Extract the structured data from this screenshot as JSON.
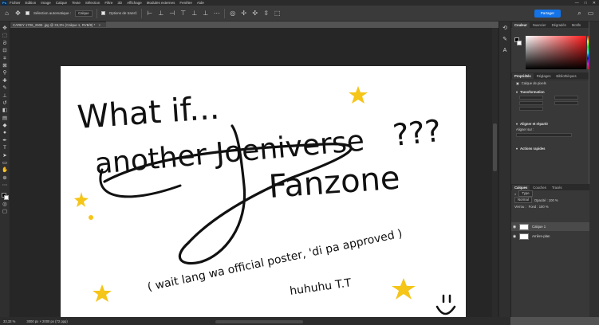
{
  "app": {
    "logo": "Ps"
  },
  "menu": [
    "Fichier",
    "Edition",
    "Image",
    "Calque",
    "Texte",
    "Sélection",
    "Filtre",
    "3D",
    "Affichage",
    "Modules externes",
    "Fenêtre",
    "Aide"
  ],
  "window_controls": [
    "—",
    "□",
    "✕"
  ],
  "options_bar": {
    "auto_select_label": "Sélection automatique :",
    "auto_select_value": "Calque",
    "transform_label": "Options de transf.",
    "share_label": "Partager"
  },
  "document_tab": {
    "title": "CAREY 1706_2606 .jpg @ 33,3% (Calque 1, RVB/8) *",
    "close": "×"
  },
  "status_bar": {
    "zoom": "33,33 %",
    "doc_info": "3000 px × 2000 px (72 ppp)"
  },
  "panels": {
    "color_tabs": [
      "Couleur",
      "Nuancier",
      "Dégradés",
      "Motifs"
    ],
    "props_tabs": [
      "Propriétés",
      "Réglages",
      "Bibliothèques"
    ],
    "props_layer_type": "Calque de pixels",
    "transform_section": "Transformation",
    "align_section": "Aligner et répartir",
    "align_label": "Aligner sur :",
    "quick_actions_section": "Actions rapides",
    "layers_tabs": [
      "Calques",
      "Couches",
      "Tracés"
    ],
    "layers_kind": "Type",
    "layers_blend": "Normal",
    "layers_opacity": "Opacité : 100 %",
    "layers_lock": "Verrou :",
    "layers_fill": "Fond : 100 %",
    "layers": [
      {
        "name": "Calque 1",
        "selected": true
      },
      {
        "name": "Arrière-plan",
        "selected": false
      }
    ]
  },
  "canvas_text": {
    "line1": "What if...",
    "line2": "another Joeniverse",
    "line3": "Fanzone",
    "qmarks": "???",
    "note1": "( wait lang wa official poster, 'di pa approved )",
    "note2": "huhuhu T.T",
    "smiley": "ü"
  },
  "colors": {
    "ink": "#111111",
    "star": "#f5c518",
    "share_button": "#1473e6"
  },
  "icons": {
    "tools": [
      "move-tool-icon",
      "artboard-icon",
      "marquee-icon",
      "lasso-icon",
      "object-select-icon",
      "crop-icon",
      "frame-icon",
      "eyedropper-icon",
      "healing-icon",
      "brush-icon",
      "stamp-icon",
      "history-brush-icon",
      "eraser-icon",
      "gradient-icon",
      "blur-icon",
      "dodge-icon",
      "pen-icon",
      "type-icon",
      "path-select-icon",
      "shape-icon",
      "hand-icon",
      "zoom-icon",
      "more-tools-icon"
    ]
  }
}
